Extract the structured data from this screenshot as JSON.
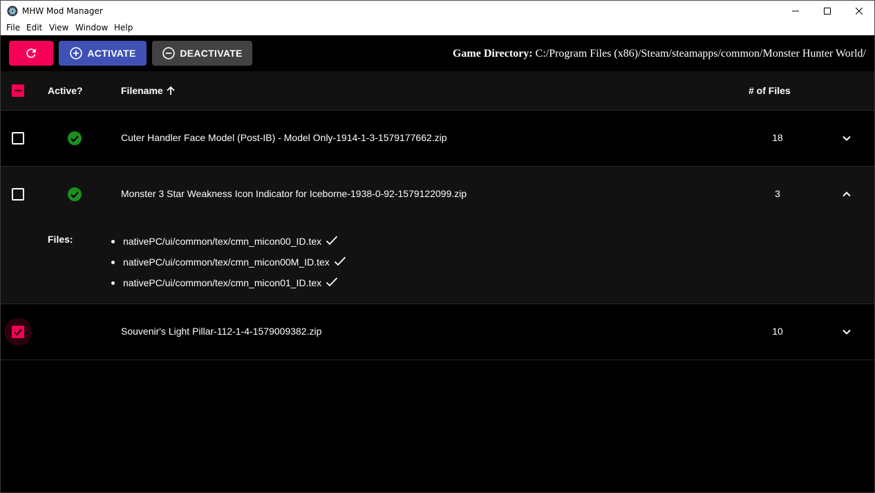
{
  "window": {
    "title": "MHW Mod Manager",
    "menu": [
      "File",
      "Edit",
      "View",
      "Window",
      "Help"
    ]
  },
  "toolbar": {
    "activate_label": "ACTIVATE",
    "deactivate_label": "DEACTIVATE",
    "game_dir_label": "Game Directory:",
    "game_dir_value": "C:/Program Files (x86)/Steam/steamapps/common/Monster Hunter World/"
  },
  "table": {
    "headers": {
      "active": "Active?",
      "filename": "Filename",
      "num_files": "# of Files"
    },
    "rows": [
      {
        "selected": false,
        "active": true,
        "filename": "Cuter Handler Face Model (Post-IB) - Model Only-1914-1-3-1579177662.zip",
        "num_files": "18",
        "expanded": false
      },
      {
        "selected": false,
        "active": true,
        "filename": "Monster 3 Star Weakness Icon Indicator for Iceborne-1938-0-92-1579122099.zip",
        "num_files": "3",
        "expanded": true,
        "files_label": "Files:",
        "files": [
          "nativePC/ui/common/tex/cmn_micon00_ID.tex",
          "nativePC/ui/common/tex/cmn_micon00M_ID.tex",
          "nativePC/ui/common/tex/cmn_micon01_ID.tex"
        ]
      },
      {
        "selected": true,
        "active": false,
        "filename": "Souvenir's Light Pillar-112-1-4-1579009382.zip",
        "num_files": "10",
        "expanded": false
      }
    ]
  },
  "colors": {
    "accent_pink": "#f50057",
    "activate_blue": "#3f51b5",
    "deactivate_gray": "#424242",
    "active_green": "#1e8e1e"
  },
  "icons": {
    "app": "app-logo-icon",
    "refresh": "refresh-icon",
    "activate": "add-circle-icon",
    "deactivate": "remove-circle-icon",
    "sort": "arrow-up-icon",
    "active": "check-circle-icon",
    "expand": "chevron-down-icon",
    "collapse": "chevron-up-icon",
    "file_ok": "check-icon"
  }
}
